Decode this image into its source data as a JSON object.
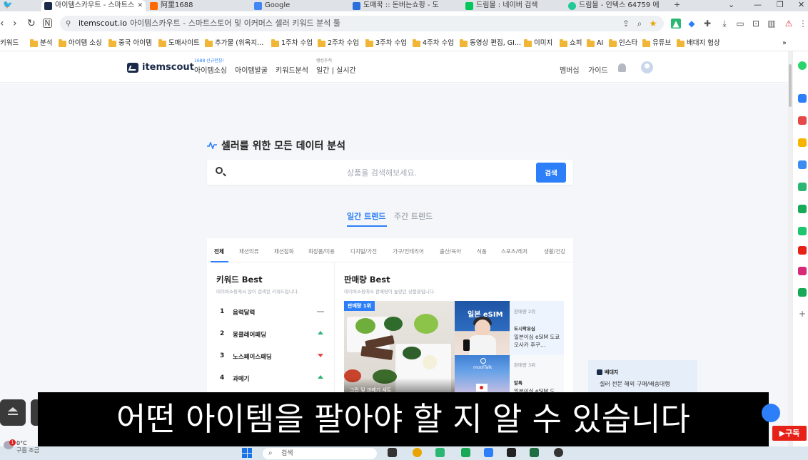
{
  "browser": {
    "tabs": [
      {
        "label": "아이템스카우트 - 스마트스",
        "active": true,
        "icon_color": "#1b2a4a"
      },
      {
        "label": "阿里1688",
        "active": false,
        "icon_color": "#ff6a00"
      },
      {
        "label": "Google",
        "active": false,
        "icon_color": "#4285f4"
      },
      {
        "label": "도매꾹 :: 돈버는쇼핑 - 도",
        "active": false,
        "icon_color": "#2a6fdb"
      },
      {
        "label": "드림몰 : 네이버 검색",
        "active": false,
        "icon_color": "#03c75a"
      },
      {
        "label": "드림몰 - 인텍스 64759 에",
        "active": false,
        "icon_color": "#20c997"
      }
    ],
    "new_tab": "+",
    "address": {
      "host": "itemscout.io",
      "title": "아이템스카우트 - 스마트스토어 및 이커머스 셀러 키워드 분석 툴"
    },
    "bookmarks": [
      "키워드",
      "분석",
      "아이템 소싱",
      "중국 아이템",
      "도매사이트",
      "추가물 (위옥지...",
      "1주차 수업",
      "2주차 수업",
      "3주차 수업",
      "4주차 수업",
      "동영상 편집, GI...",
      "이미지",
      "쇼피",
      "AI",
      "인스타",
      "유튜브",
      "배대지 협상"
    ],
    "bookmarks_more": "»"
  },
  "site": {
    "logo": "itemscout",
    "nav": [
      {
        "label": "아이템소싱",
        "sup": "1688 신규런칭!"
      },
      {
        "label": "아이템발굴",
        "sup": ""
      },
      {
        "label": "키워드분석",
        "sup": ""
      },
      {
        "label": "일간 | 실시간",
        "sup": "랭킹추적"
      }
    ],
    "right": [
      "멤버십",
      "가이드"
    ]
  },
  "main": {
    "headline": "셀러를 위한 모든 데이터 분석",
    "search_placeholder": "상품을 검색해보세요.",
    "search_button": "검색",
    "trend_tabs": [
      "일간 트렌드",
      "주간 트렌드"
    ],
    "active_trend_tab": 0,
    "categories": [
      "전체",
      "패션의류",
      "패션잡화",
      "화장품/미용",
      "디지털/가전",
      "가구/인테리어",
      "출산/육아",
      "식품",
      "스포츠/레저",
      "생활/건강"
    ],
    "active_category": 0,
    "keyword_best": {
      "title": "키워드 Best",
      "subtitle": "네이버쇼핑에서 많이 검색된 키워드입니다.",
      "items": [
        {
          "rank": "1",
          "keyword": "음력달력",
          "trend": "same"
        },
        {
          "rank": "2",
          "keyword": "몽클레어패딩",
          "trend": "up"
        },
        {
          "rank": "3",
          "keyword": "노스페이스패딩",
          "trend": "down"
        },
        {
          "rank": "4",
          "keyword": "과메기",
          "trend": "up"
        }
      ]
    },
    "sales_best": {
      "title": "판매량 Best",
      "subtitle": "네이버쇼핑에서 판매량이 높았던 상품들입니다.",
      "badge": "판매량 1위",
      "main_caption": "그린 및 과메기 세트",
      "image2_text": "일본 eSIM",
      "image3_text": "moolTalk",
      "items": [
        {
          "rank": "판매량 2위",
          "shop": "도시락유심",
          "name": "일본이심 eSIM 도쿄 오사카 후쿠…"
        },
        {
          "rank": "판매량 3위",
          "shop": "말톡",
          "name": "일본이심 eSIM 도"
        }
      ]
    },
    "ad": {
      "brand": "배대지",
      "text": "셀러 전문 해외 구매/배송대행"
    }
  },
  "subtitle": "어떤 아이템을 팔아야 할 지 알 수 있습니다",
  "subscribe": "▶구독",
  "taskbar": {
    "temp": "0°C",
    "weather": "구름 조금",
    "notification": "1",
    "search": "검색"
  },
  "colors": {
    "accent": "#2d7ff9",
    "up": "#2bb673",
    "down": "#e54848",
    "brand_navy": "#1b2a4a"
  }
}
